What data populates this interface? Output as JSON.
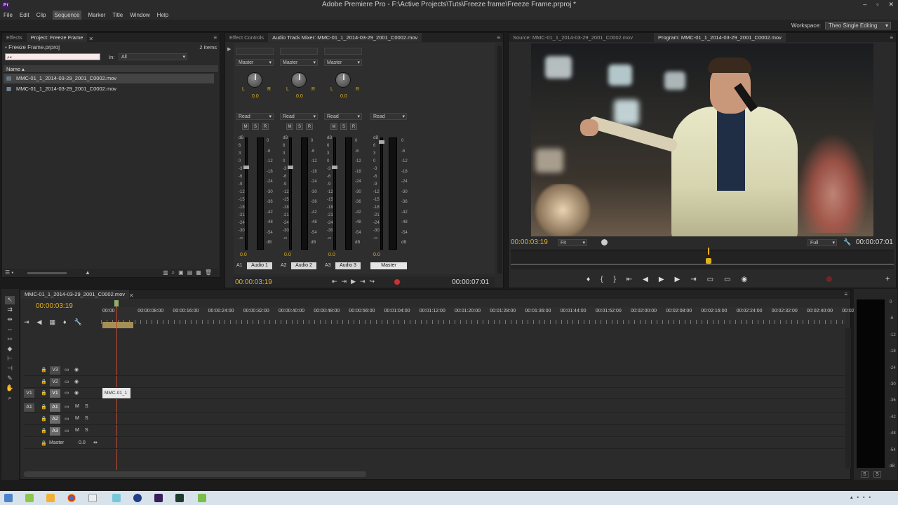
{
  "app": {
    "title": "Adobe Premiere Pro - F:\\Active Projects\\Tuts\\Freeze frame\\Freeze Frame.prproj *",
    "icon_text": "Pr",
    "window_controls": [
      "–",
      "▫",
      "✕"
    ]
  },
  "menu": [
    "File",
    "Edit",
    "Clip",
    "Sequence",
    "Marker",
    "Title",
    "Window",
    "Help"
  ],
  "workspace": {
    "label": "Workspace:",
    "value": "Theo Single Editing"
  },
  "project_panel": {
    "tabs": [
      "Effects",
      "Project: Freeze Frame"
    ],
    "project_file": "Freeze Frame.prproj",
    "items_count": "2 Items",
    "search_placeholder": "",
    "in_label": "In:",
    "in_value": "All",
    "column_name": "Name",
    "items": [
      "MMC-01_1_2014-03-29_2001_C0002.mov",
      "MMC-01_1_2014-03-29_2001_C0002.mov"
    ]
  },
  "mixer_panel": {
    "tabs": [
      "Effect Controls",
      "Audio Track Mixer: MMC-01_1_2014-03-29_2001_C0002.mov"
    ],
    "channels": [
      {
        "route": "Master",
        "pan_value": "0.0",
        "mode": "Read",
        "vol": "0.0",
        "id": "A1",
        "name": "Audio 1"
      },
      {
        "route": "Master",
        "pan_value": "0.0",
        "mode": "Read",
        "vol": "0.0",
        "id": "A2",
        "name": "Audio 2"
      },
      {
        "route": "Master",
        "pan_value": "0.0",
        "mode": "Read",
        "vol": "0.0",
        "id": "A3",
        "name": "Audio 3"
      }
    ],
    "master": {
      "mode": "Read",
      "vol": "0.0",
      "name": "Master"
    },
    "msr": [
      "M",
      "S",
      "R"
    ],
    "lr": [
      "L",
      "R"
    ],
    "scale_left": [
      "dB",
      "6",
      "3",
      "0",
      "-3",
      "-6",
      "-9",
      "-12",
      "-15",
      "-18",
      "-21",
      "-24",
      "-30",
      "-∞"
    ],
    "scale_right": [
      "0",
      "-6",
      "-12",
      "-18",
      "-24",
      "-30",
      "-36",
      "-42",
      "-48",
      "-54",
      "dB"
    ],
    "timecode_current": "00:00:03:19",
    "timecode_duration": "00:00:07:01"
  },
  "program_panel": {
    "tabs": [
      "Source: MMC-01_1_2014-03-29_2001_C0002.mov",
      "Program: MMC-01_1_2014-03-29_2001_C0002.mov"
    ],
    "timecode_current": "00:00:03:19",
    "fit": "Fit",
    "quality": "Full",
    "timecode_duration": "00:00:07:01"
  },
  "timeline": {
    "tab": "MMC-01_1_2014-03-29_2001_C0002.mov",
    "timecode": "00:00:03:19",
    "ruler": [
      "00:00",
      "00:00:08:00",
      "00:00:16:00",
      "00:00:24:00",
      "00:00:32:00",
      "00:00:40:00",
      "00:00:48:00",
      "00:00:56:00",
      "00:01:04:00",
      "00:01:12:00",
      "00:01:20:00",
      "00:01:28:00",
      "00:01:36:00",
      "00:01:44:00",
      "00:01:52:00",
      "00:02:00:00",
      "00:02:08:00",
      "00:02:16:00",
      "00:02:24:00",
      "00:02:32:00",
      "00:02:40:00",
      "00:02:4"
    ],
    "video_tracks": [
      "V3",
      "V2",
      "V1"
    ],
    "audio_tracks": [
      "A1",
      "A2",
      "A3"
    ],
    "source_v": "V1",
    "source_a": "A1",
    "clip_label": "MMC-01_1",
    "master_label": "Master",
    "master_value": "0.0",
    "ms": [
      "M",
      "S"
    ]
  },
  "meter_scale": [
    "0",
    "-6",
    "-12",
    "-18",
    "-24",
    "-30",
    "-36",
    "-42",
    "-48",
    "-54",
    "dB"
  ],
  "meter_buttons": [
    "S",
    "S"
  ]
}
